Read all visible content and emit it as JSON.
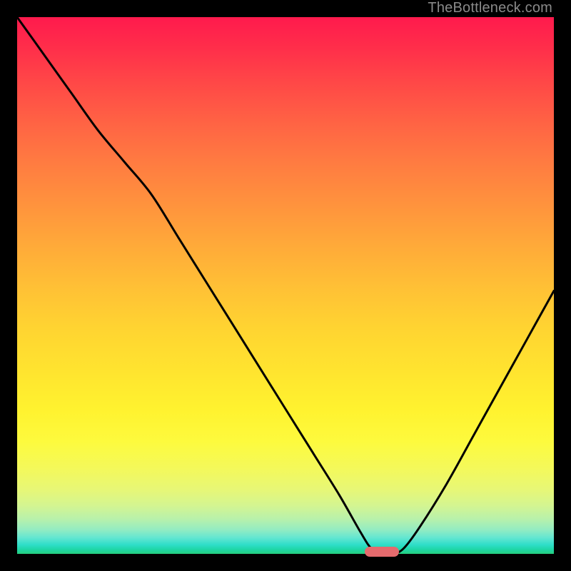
{
  "watermark": "TheBottleneck.com",
  "colors": {
    "curve_stroke": "#000000",
    "pill": "#e46a6d"
  },
  "chart_data": {
    "type": "line",
    "title": "",
    "xlabel": "",
    "ylabel": "",
    "xlim": [
      0,
      100
    ],
    "ylim": [
      0,
      100
    ],
    "grid": false,
    "legend": false,
    "note": "Axes are unlabeled; values are read as percentage of plot area from gridless interpolation. y=0 is bottom (green / no bottleneck), y=100 is top (red / max bottleneck). Curve is a V reaching minimum near x≈68.",
    "series": [
      {
        "name": "bottleneck-curve",
        "x": [
          0,
          5,
          10,
          15,
          20,
          25,
          30,
          35,
          40,
          45,
          50,
          55,
          60,
          64,
          66,
          68,
          70,
          72,
          75,
          80,
          85,
          90,
          95,
          100
        ],
        "y": [
          100,
          93,
          86,
          79,
          73,
          67,
          59,
          51,
          43,
          35,
          27,
          19,
          11,
          4,
          1,
          0,
          0,
          1,
          5,
          13,
          22,
          31,
          40,
          49
        ]
      }
    ],
    "marker": {
      "name": "optimal-indicator",
      "x": 68,
      "y": 0,
      "shape": "pill",
      "color": "#e46a6d"
    }
  }
}
